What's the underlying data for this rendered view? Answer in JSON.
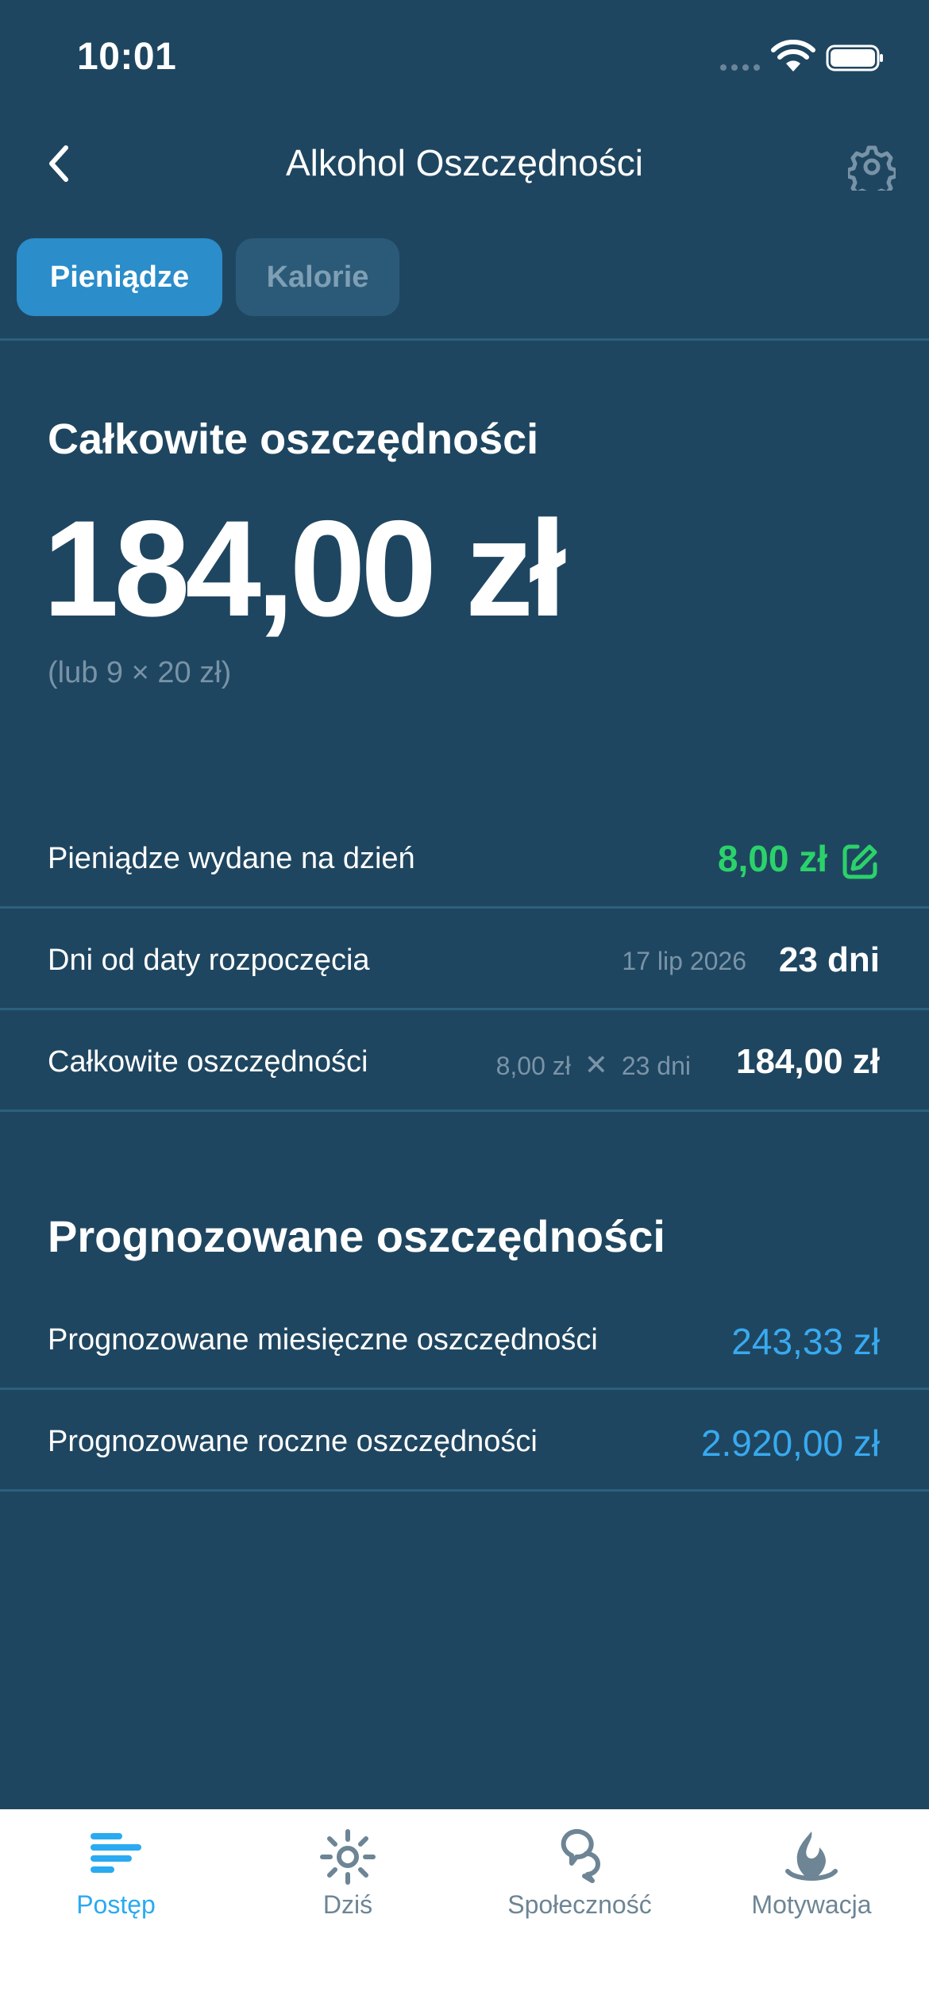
{
  "status_bar": {
    "time": "10:01"
  },
  "nav": {
    "title": "Alkohol Oszczędności"
  },
  "tabs": {
    "money": "Pieniądze",
    "calories": "Kalorie"
  },
  "hero": {
    "label": "Całkowite oszczędności",
    "amount": "184,00 zł",
    "sub": "(lub 9 × 20 zł)"
  },
  "rows": {
    "per_day": {
      "label": "Pieniądze wydane na dzień",
      "value": "8,00 zł"
    },
    "days": {
      "label": "Dni od daty rozpoczęcia",
      "date": "17 lip 2026",
      "value": "23 dni"
    },
    "total": {
      "label": "Całkowite oszczędności",
      "calc_a": "8,00 zł",
      "calc_op": "✕",
      "calc_b": "23 dni",
      "value": "184,00 zł"
    }
  },
  "forecast": {
    "title": "Prognozowane oszczędności",
    "monthly": {
      "label": "Prognozowane miesięczne oszczędności",
      "value": "243,33 zł"
    },
    "yearly": {
      "label": "Prognozowane roczne oszczędności",
      "value": "2.920,00 zł"
    }
  },
  "tabbar": {
    "items": [
      {
        "label": "Postęp",
        "icon": "progress-icon",
        "active": true
      },
      {
        "label": "Dziś",
        "icon": "sun-icon",
        "active": false
      },
      {
        "label": "Społeczność",
        "icon": "community-icon",
        "active": false
      },
      {
        "label": "Motywacja",
        "icon": "motivation-icon",
        "active": false
      }
    ]
  },
  "colors": {
    "background": "#1f4660",
    "accent": "#2b8dca",
    "positive": "#2bd26a",
    "link": "#38aaf0"
  }
}
